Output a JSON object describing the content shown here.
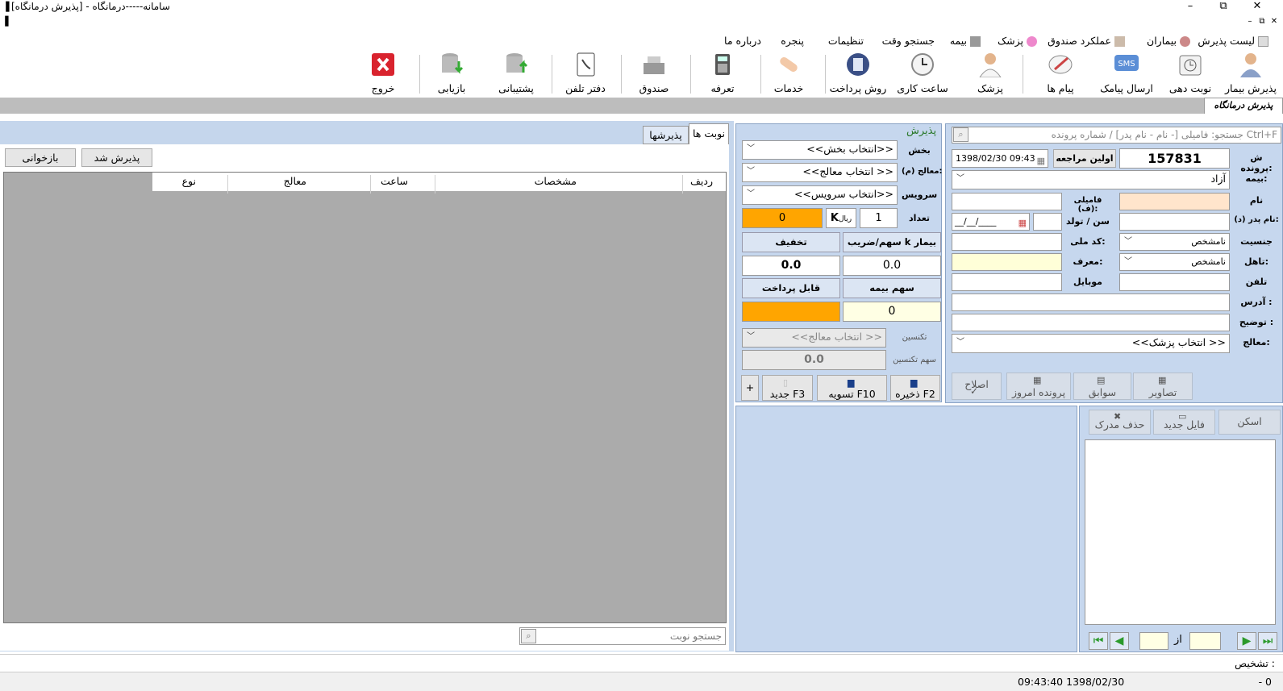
{
  "window": {
    "title": "سامانه-----درمانگاه - [پذیرش درمانگاه]",
    "min": "–",
    "restore": "⧉",
    "close": "✕"
  },
  "mdi": {
    "min": "–",
    "restore": "⧉",
    "close": "✕"
  },
  "menu": [
    "لیست پذیرش",
    "بیماران",
    "عملکرد صندوق",
    "پزشک",
    "بیمه",
    "جستجو وقت",
    "تنظیمات",
    "پنجره",
    "درباره ما"
  ],
  "toolbar": {
    "patient_admit": "پذیرش بیمار",
    "appointment": "نوبت دهی",
    "send_sms": "ارسال پیامک",
    "messages": "پیام ها",
    "doctor": "پزشک",
    "working_hours": "ساعت کاری",
    "payment_method": "روش پرداخت",
    "services": "خدمات",
    "tariff": "تعرفه",
    "cashbox": "صندوق",
    "phonebook": "دفتر تلفن",
    "backup": "پشتیبانی",
    "restore": "بازیابی",
    "exit": "خروج",
    "sms_badge": "SMS"
  },
  "form_tab": "پذیرش درمانگاه",
  "list": {
    "tab_appointments": "نوبت ها",
    "tab_admissions": "پذیرشها",
    "admitted_button": "پذیرش شد",
    "reload_button": "بازخوانی",
    "columns": [
      "ردیف",
      "مشخصات",
      "ساعت",
      "معالج",
      "نوع"
    ],
    "search_placeholder": "جستجو نوبت"
  },
  "admission": {
    "title": "پذیرش",
    "section_label": "بخش",
    "section_value": "<<انتخاب بخش>>",
    "doctor_label": "معالج (م):",
    "doctor_value": "<< انتخاب معالج>>",
    "service_label": "سرویس",
    "service_value": "<<انتخاب سرویس>>",
    "count_label": "تعداد",
    "count_value": "1",
    "k_unit": "ریال",
    "k_letter": "K",
    "price_value": "0",
    "share_header": "سهم/ضریب k بیمار",
    "discount_header": "تخفیف",
    "share_value": "0.0",
    "discount_value": "0.0",
    "insurance_header": "سهم بیمه",
    "payable_header": "قابل پرداخت",
    "insurance_value": "0",
    "payable_value": "",
    "tech_label": "تکنسین",
    "tech_value": "<< انتخاب معالج>>",
    "tech_share_label": "سهم تکنسین",
    "tech_share_value": "0.0",
    "save_button": "ذخیره F2",
    "settle_button": "تسویه F10",
    "new_button": "جدید F3",
    "plus_button": "+"
  },
  "patient": {
    "search_placeholder": "Ctrl+F جستجو: فامیلی [- نام - نام پدر] / شماره پرونده",
    "file_no_label": "ش پرونده:",
    "file_no_value": "157831",
    "first_visit_button": "اولین مراجعه",
    "date_time": "1398/02/30 09:43",
    "insurance_label": "بیمه:",
    "insurance_value": "آزاد",
    "name_label": "نام",
    "family_label": "فامیلی (ف):",
    "father_label": "نام پدر (د):",
    "age_label": "سن / تولد",
    "birth_placeholder": "__/__/____",
    "gender_label": "جنسیت",
    "gender_value": "نامشخص",
    "national_label": "کد ملی:",
    "marital_label": "تاهل:",
    "marital_value": "نامشخص",
    "referrer_label": "معرف:",
    "phone_label": "تلفن",
    "mobile_label": "موبایل",
    "address_label": "آدرس :",
    "note_label": "توضیح :",
    "physician_label": "معالج:",
    "physician_value": "<< انتخاب پزشک>>",
    "images_button": "تصاویر",
    "history_button": "سوابق",
    "today_file_button": "پرونده امروز",
    "edit_button": "اصلاح"
  },
  "documents": {
    "scan_button": "اسکن",
    "new_file_button": "فایل جدید",
    "delete_button": "حذف مدرک",
    "of_label": "از"
  },
  "diagnosis_label": "تشخیص :",
  "status": {
    "datetime": "09:43:40 1398/02/30",
    "right_text": "- 0"
  },
  "colors": {
    "accent_orange": "#ffa500",
    "exit_red": "#d9232e",
    "panel_blue": "#c6d7ee"
  }
}
